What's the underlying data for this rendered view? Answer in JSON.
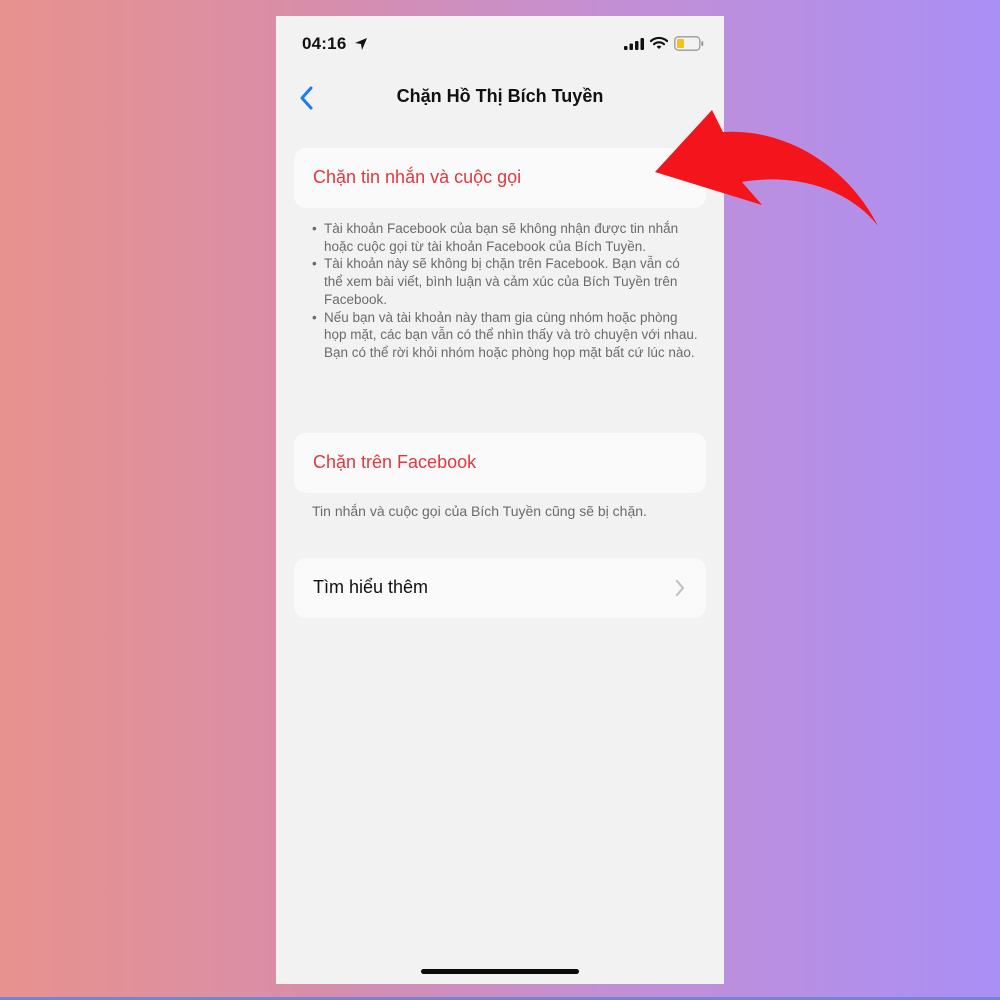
{
  "status_bar": {
    "time": "04:16"
  },
  "nav": {
    "back_icon": "chevron-left-icon",
    "title": "Chặn Hồ Thị Bích Tuyền"
  },
  "block_messages": {
    "label": "Chặn tin nhắn và cuộc gọi",
    "notes": [
      "Tài khoản Facebook của bạn sẽ không nhận được tin nhắn hoặc cuộc gọi từ tài khoản Facebook của Bích Tuyền.",
      "Tài khoản này sẽ không bị chặn trên Facebook. Bạn vẫn có thể xem bài viết, bình luận và cảm xúc của Bích Tuyền trên Facebook.",
      "Nếu bạn và tài khoản này tham gia cùng nhóm hoặc phòng họp mặt, các bạn vẫn có thể nhìn thấy và trò chuyện với nhau. Bạn có thể rời khỏi nhóm hoặc phòng họp mặt bất cứ lúc nào."
    ]
  },
  "block_facebook": {
    "label": "Chặn trên Facebook",
    "note": "Tin nhắn và cuộc gọi của Bích Tuyền cũng sẽ bị chặn."
  },
  "learn_more": {
    "label": "Tìm hiểu thêm"
  },
  "colors": {
    "destructive": "#e0383e",
    "ios_blue": "#1a7cf5",
    "annotation_arrow": "#f4141c"
  }
}
